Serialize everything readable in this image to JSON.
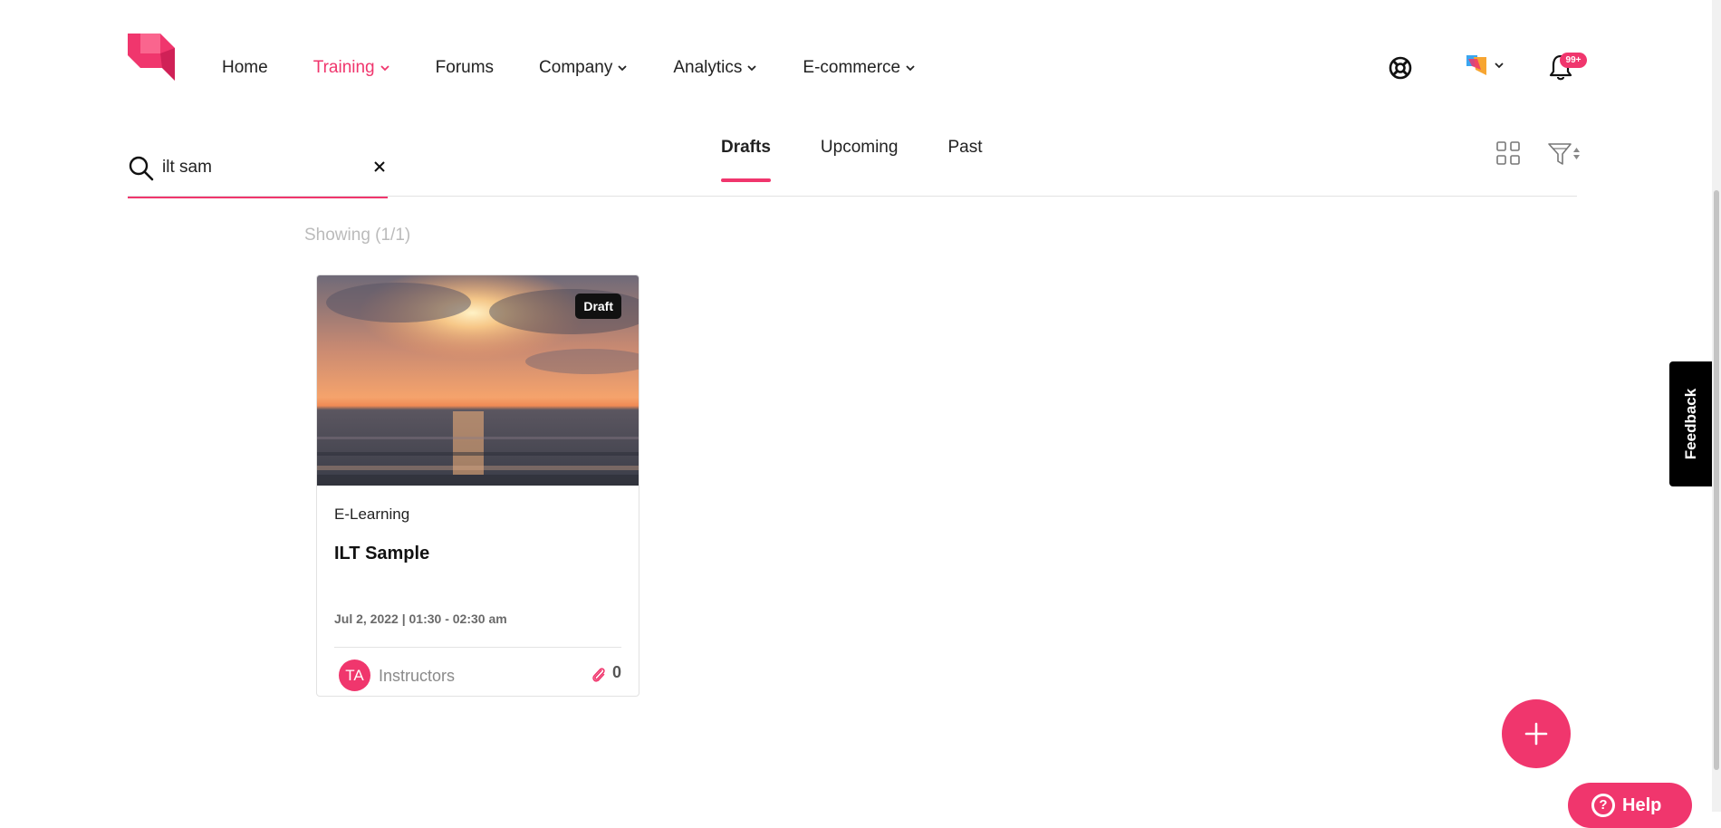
{
  "nav": {
    "items": [
      {
        "label": "Home",
        "has_dropdown": false,
        "active": false
      },
      {
        "label": "Training",
        "has_dropdown": true,
        "active": true
      },
      {
        "label": "Forums",
        "has_dropdown": false,
        "active": false
      },
      {
        "label": "Company",
        "has_dropdown": true,
        "active": false
      },
      {
        "label": "Analytics",
        "has_dropdown": true,
        "active": false
      },
      {
        "label": "E-commerce",
        "has_dropdown": true,
        "active": false
      }
    ],
    "icons": {
      "support": "lifebuoy-icon",
      "org": "org-logo-icon",
      "notifications": "bell-icon"
    },
    "notification_badge": "99+"
  },
  "search": {
    "value": "ilt sam",
    "placeholder": ""
  },
  "tabs": [
    {
      "label": "Drafts",
      "active": true
    },
    {
      "label": "Upcoming",
      "active": false
    },
    {
      "label": "Past",
      "active": false
    }
  ],
  "results": {
    "showing": "Showing (1/1)"
  },
  "cards": [
    {
      "status": "Draft",
      "type": "E-Learning",
      "title": "ILT Sample",
      "date": "Jul 2, 2022 | 01:30 - 02:30 am",
      "avatar": "TA",
      "instructors": "Instructors",
      "attachments": "0"
    }
  ],
  "feedback": {
    "label": "Feedback"
  },
  "help": {
    "label": "Help"
  },
  "colors": {
    "accent": "#f0366d",
    "text": "#222222",
    "muted": "#bbbbbb"
  }
}
